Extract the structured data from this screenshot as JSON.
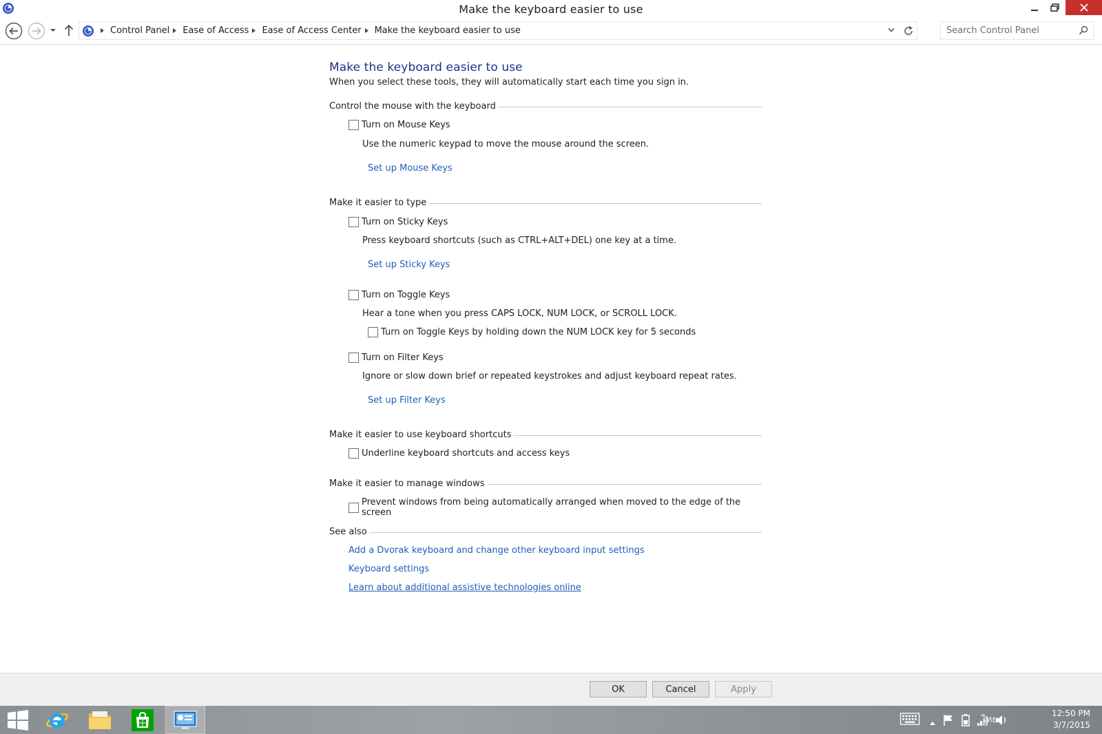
{
  "window": {
    "title": "Make the keyboard easier to use"
  },
  "address_bar": {
    "breadcrumbs": [
      "Control Panel",
      "Ease of Access",
      "Ease of Access Center",
      "Make the keyboard easier to use"
    ],
    "search_placeholder": "Search Control Panel"
  },
  "page": {
    "title": "Make the keyboard easier to use",
    "subtitle": "When you select these tools, they will automatically start each time you sign in."
  },
  "sections": {
    "mouse": {
      "heading": "Control the mouse with the keyboard",
      "mouse_keys_label": "Turn on Mouse Keys",
      "mouse_keys_desc": "Use the numeric keypad to move the mouse around the screen.",
      "mouse_keys_link": "Set up Mouse Keys"
    },
    "typing": {
      "heading": "Make it easier to type",
      "sticky_label": "Turn on Sticky Keys",
      "sticky_desc": "Press keyboard shortcuts (such as CTRL+ALT+DEL) one key at a time.",
      "sticky_link": "Set up Sticky Keys",
      "toggle_label": "Turn on Toggle Keys",
      "toggle_desc": "Hear a tone when you press CAPS LOCK, NUM LOCK, or SCROLL LOCK.",
      "toggle_numlock_label": "Turn on Toggle Keys by holding down the NUM LOCK key for 5 seconds",
      "filter_label": "Turn on Filter Keys",
      "filter_desc": "Ignore or slow down brief or repeated keystrokes and adjust keyboard repeat rates.",
      "filter_link": "Set up Filter Keys"
    },
    "shortcuts": {
      "heading": "Make it easier to use keyboard shortcuts",
      "underline_label": "Underline keyboard shortcuts and access keys"
    },
    "windows": {
      "heading": "Make it easier to manage windows",
      "prevent_label": "Prevent windows from being automatically arranged when moved to the edge of the screen"
    },
    "see_also": {
      "heading": "See also",
      "links": [
        "Add a Dvorak keyboard and change other keyboard input settings",
        "Keyboard settings",
        "Learn about additional assistive technologies online"
      ]
    }
  },
  "buttons": {
    "ok": "OK",
    "cancel": "Cancel",
    "apply": "Apply"
  },
  "taskbar": {
    "language": "ไทย",
    "time": "12:50 PM",
    "date": "3/7/2015"
  },
  "colors": {
    "title_blue": "#1e3287",
    "link_blue": "#1f5db8",
    "close_red": "#c7312b"
  }
}
